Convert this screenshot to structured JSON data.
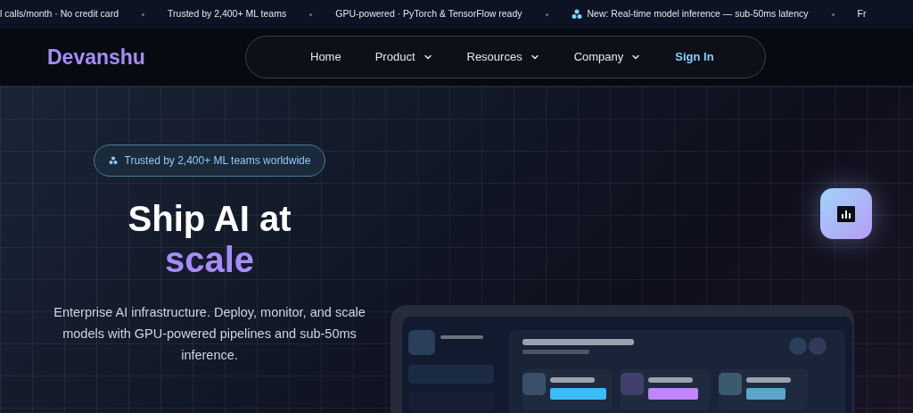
{
  "ticker": [
    {
      "text": "l calls/month · No credit card",
      "icon": false
    },
    {
      "text": "Trusted by 2,400+ ML teams",
      "icon": false
    },
    {
      "text": "GPU-powered · PyTorch & TensorFlow ready",
      "icon": false
    },
    {
      "text": "New: Real-time model inference — sub-50ms latency",
      "icon": true
    },
    {
      "text": "Fr",
      "icon": false
    }
  ],
  "nav": {
    "logo": "Devanshu",
    "links": [
      {
        "label": "Home",
        "dropdown": false,
        "kind": "link"
      },
      {
        "label": "Product",
        "dropdown": true,
        "kind": "link"
      },
      {
        "label": "Resources",
        "dropdown": true,
        "kind": "link"
      },
      {
        "label": "Company",
        "dropdown": true,
        "kind": "link"
      },
      {
        "label": "Sign In",
        "dropdown": false,
        "kind": "accent"
      }
    ]
  },
  "hero": {
    "badge": "Trusted by 2,400+ ML teams worldwide",
    "title": "Ship AI at",
    "title_accent": "scale",
    "description": "Enterprise AI infrastructure. Deploy, monitor, and scale models with GPU-powered pipelines and sub-50ms inference."
  }
}
